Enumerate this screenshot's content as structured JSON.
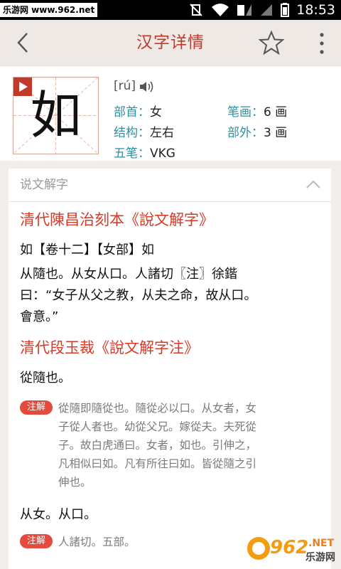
{
  "status_bar": {
    "site_badge": "乐游网 www.962.net",
    "time": "18:53"
  },
  "appbar": {
    "title": "汉字详情",
    "back_icon": "chevron-left-icon",
    "favorite_icon": "star-outline-icon",
    "more_icon": "more-vertical-icon"
  },
  "char_info": {
    "character": "如",
    "pinyin": "[rú]",
    "bushou_label": "部首：",
    "bushou": "女",
    "bihua_label": "笔画：",
    "bihua": "6 画",
    "jiegou_label": "结构：",
    "jiegou": "左右",
    "buwai_label": "部外：",
    "buwai": "3 画",
    "wubi_label": "五笔：",
    "wubi": "VKG"
  },
  "shuowen": {
    "header": "说文解字",
    "section1_title": "清代陳昌治刻本《說文解字》",
    "s1_line1": "如【卷十二】【女部】如",
    "s1_line2": "从隨也。从女从口。人諸切〖注〗徐鍇",
    "s1_line3": "曰：“女子从父之教，从夫之命，故从口。",
    "s1_line4": "會意。”",
    "section2_title": "清代段玉裁《說文解字注》",
    "s2_line1": "從隨也。",
    "note_badge": "注解",
    "note1_line1": "從隨即隨從也。隨從必以口。从女者，女",
    "note1_line2": "子從人者也。幼從父兄。嫁從夫。夫死從",
    "note1_line3": "子。故白虎通曰。女者，如也。引伸之，",
    "note1_line4": "凡相似曰如。凡有所往曰如。皆從隨之引",
    "note1_line5": "伸也。",
    "s2_line2": "从女。从口。",
    "note2_line1": "人諸切。五部。"
  },
  "watermark": {
    "logo_text": "962",
    "suffix": ".NET",
    "caption": "乐游网"
  }
}
